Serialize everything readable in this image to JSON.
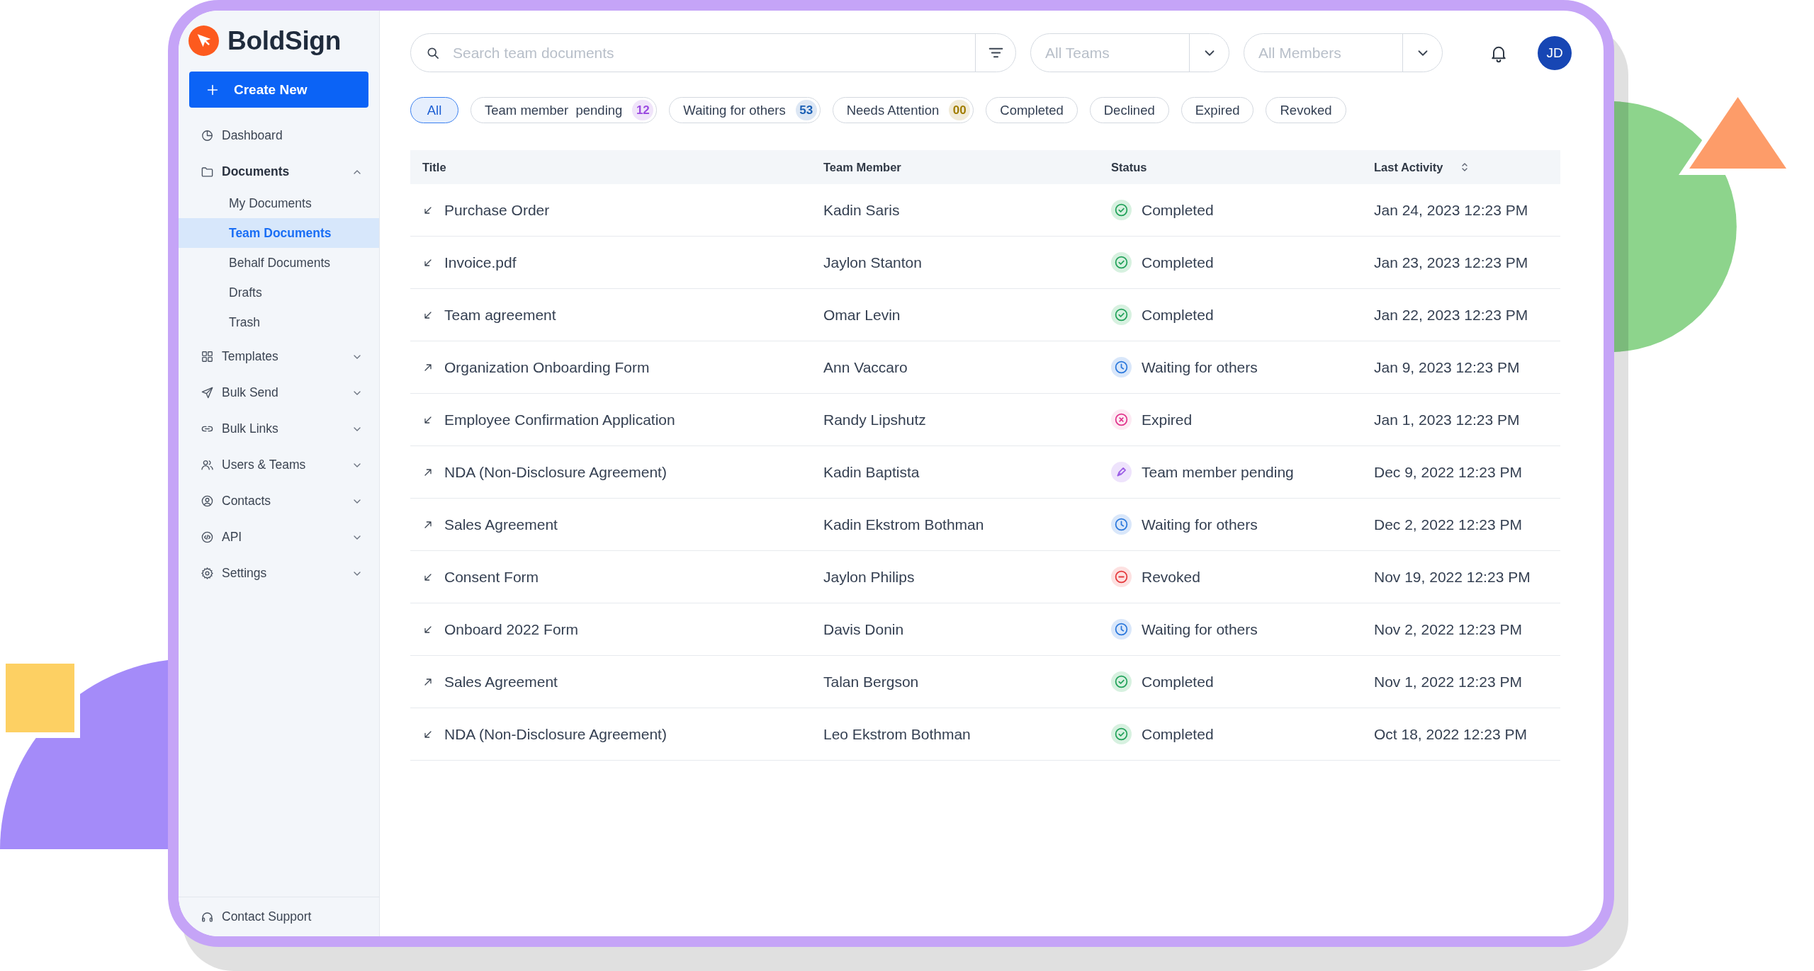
{
  "sidebar": {
    "logo": "BoldSign",
    "create_button": "Create New",
    "items": [
      {
        "label": "Dashboard",
        "selected": false
      },
      {
        "label": "Documents",
        "selected": false,
        "expanded": true,
        "children": [
          {
            "label": "My Documents",
            "selected": false
          },
          {
            "label": "Team Documents",
            "selected": true
          },
          {
            "label": "Behalf Documents",
            "selected": false
          },
          {
            "label": "Drafts",
            "selected": false
          },
          {
            "label": "Trash",
            "selected": false
          }
        ]
      },
      {
        "label": "Templates",
        "selected": false,
        "expanded": false
      },
      {
        "label": "Bulk Send",
        "selected": false,
        "expanded": false
      },
      {
        "label": "Bulk Links",
        "selected": false,
        "expanded": false
      },
      {
        "label": "Users & Teams",
        "selected": false,
        "expanded": false
      },
      {
        "label": "Contacts",
        "selected": false,
        "expanded": false
      },
      {
        "label": "API",
        "selected": false,
        "expanded": false
      },
      {
        "label": "Settings",
        "selected": false,
        "expanded": false
      }
    ],
    "footer_link": "Contact Support"
  },
  "toolbar": {
    "search": {
      "placeholder": "Search team documents"
    },
    "team_select": {
      "placeholder": "All Teams"
    },
    "member_select": {
      "placeholder": "All Members"
    },
    "avatar": "JD"
  },
  "chips": [
    {
      "label": "All",
      "selected": true
    },
    {
      "label": "Team member  pending",
      "selected": false,
      "count": {
        "text": "12",
        "color": "#9b4be0"
      }
    },
    {
      "label": "Waiting for others",
      "selected": false,
      "count": {
        "text": "53",
        "color": "#1a5fb4"
      }
    },
    {
      "label": "Needs Attention",
      "selected": false,
      "count": {
        "text": "00",
        "color": "#a07c00"
      }
    },
    {
      "label": "Completed",
      "selected": false
    },
    {
      "label": "Declined",
      "selected": false
    },
    {
      "label": "Expired",
      "selected": false
    },
    {
      "label": "Revoked",
      "selected": false
    }
  ],
  "table": {
    "columns": [
      {
        "label": "Title"
      },
      {
        "label": "Team Member"
      },
      {
        "label": "Status"
      },
      {
        "label": "Last Activity",
        "sortable": true
      }
    ],
    "rows": [
      {
        "kind": "incoming",
        "title": "Purchase Order",
        "team_member": "Kadin Saris",
        "status": {
          "kind": "completed",
          "label": "Completed"
        },
        "last_activity": "Jan 24, 2023 12:23 PM"
      },
      {
        "kind": "incoming",
        "title": "Invoice.pdf",
        "team_member": "Jaylon Stanton",
        "status": {
          "kind": "completed",
          "label": "Completed"
        },
        "last_activity": "Jan 23, 2023 12:23 PM"
      },
      {
        "kind": "incoming",
        "title": "Team agreement",
        "team_member": "Omar Levin",
        "status": {
          "kind": "completed",
          "label": "Completed"
        },
        "last_activity": "Jan 22, 2023 12:23 PM"
      },
      {
        "kind": "outgoing",
        "title": "Organization Onboarding Form",
        "team_member": "Ann Vaccaro",
        "status": {
          "kind": "waiting",
          "label": "Waiting for others"
        },
        "last_activity": "Jan 9, 2023 12:23 PM"
      },
      {
        "kind": "incoming",
        "title": "Employee Confirmation Application",
        "team_member": "Randy Lipshutz",
        "status": {
          "kind": "expired",
          "label": "Expired"
        },
        "last_activity": "Jan 1, 2023 12:23 PM"
      },
      {
        "kind": "outgoing",
        "title": "NDA (Non-Disclosure Agreement)",
        "team_member": "Kadin Baptista",
        "status": {
          "kind": "pending",
          "label": "Team member pending"
        },
        "last_activity": "Dec 9, 2022 12:23 PM"
      },
      {
        "kind": "outgoing",
        "title": "Sales Agreement",
        "team_member": "Kadin Ekstrom Bothman",
        "status": {
          "kind": "waiting",
          "label": "Waiting for others"
        },
        "last_activity": "Dec 2, 2022 12:23 PM"
      },
      {
        "kind": "incoming",
        "title": "Consent Form",
        "team_member": "Jaylon Philips",
        "status": {
          "kind": "revoked",
          "label": "Revoked"
        },
        "last_activity": "Nov 19, 2022 12:23 PM"
      },
      {
        "kind": "incoming",
        "title": "Onboard 2022 Form",
        "team_member": "Davis Donin",
        "status": {
          "kind": "waiting",
          "label": "Waiting for others"
        },
        "last_activity": "Nov 2, 2022 12:23 PM"
      },
      {
        "kind": "outgoing",
        "title": "Sales Agreement",
        "team_member": "Talan Bergson",
        "status": {
          "kind": "completed",
          "label": "Completed"
        },
        "last_activity": "Nov 1, 2022 12:23 PM"
      },
      {
        "kind": "incoming",
        "title": "NDA (Non-Disclosure Agreement)",
        "team_member": "Leo Ekstrom Bothman",
        "status": {
          "kind": "completed",
          "label": "Completed"
        },
        "last_activity": "Oct 18, 2022 12:23 PM"
      }
    ]
  }
}
